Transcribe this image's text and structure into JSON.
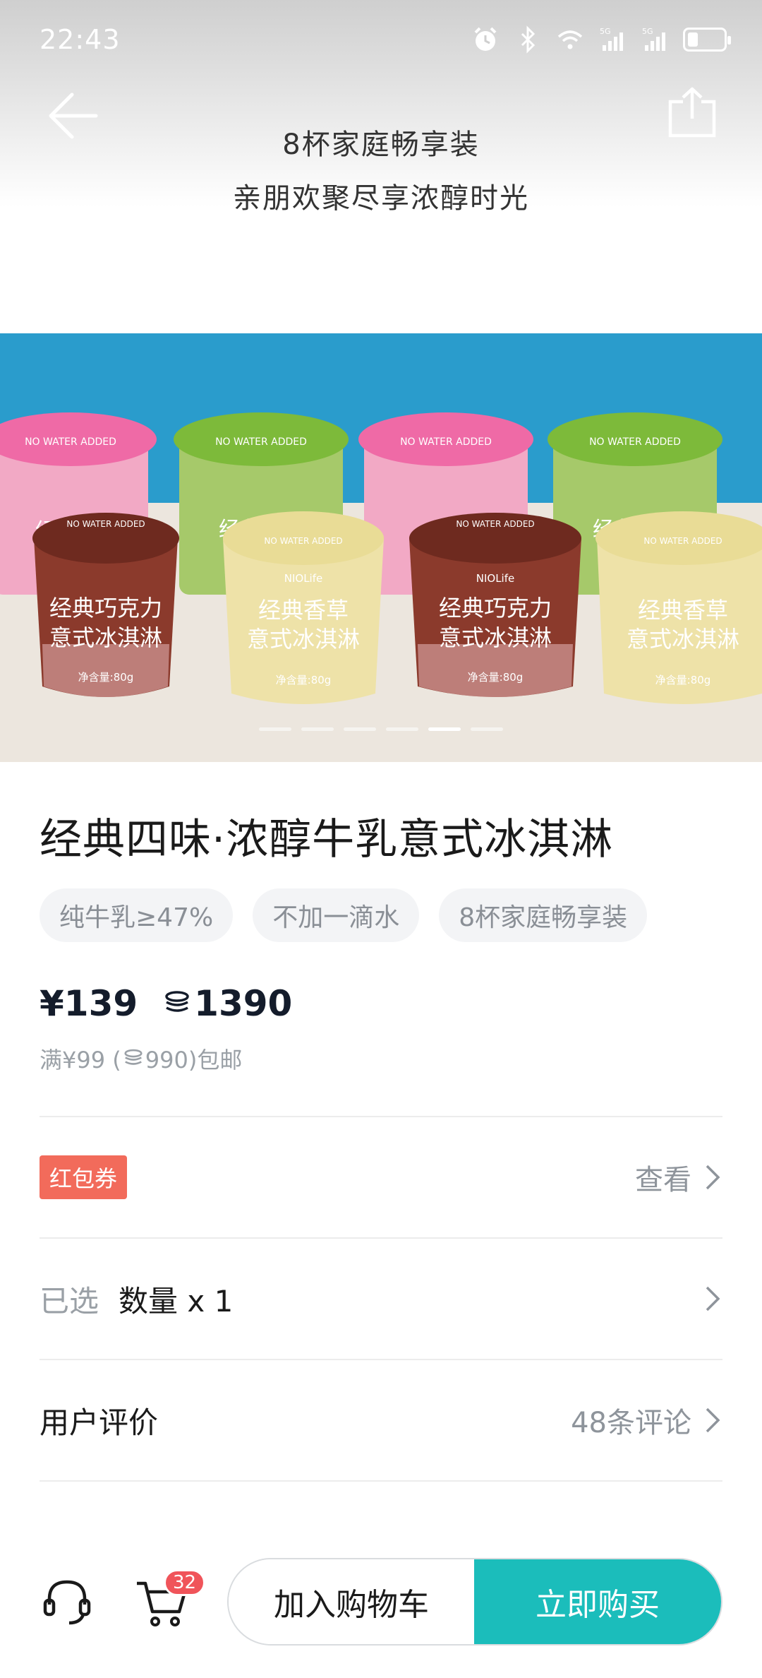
{
  "status_bar": {
    "time": "22:43",
    "signal1": "5G",
    "signal2": "5G"
  },
  "header": {
    "promo_line1": "8杯家庭畅享装",
    "promo_line2": "亲朋欢聚尽享浓醇时光"
  },
  "banner": {
    "slide_count": 6,
    "active_slide": 5,
    "cup_top_text": "NO WATER ADDED",
    "brand": "NIOLife",
    "cups": [
      {
        "name_line1": "经典巧克力",
        "name_line2": "意式冰淇淋",
        "net": "净含量:80g"
      },
      {
        "name_line1": "经典香草",
        "name_line2": "意式冰淇淋",
        "net": "净含量:80g"
      },
      {
        "name_line1": "经典巧克力",
        "name_line2": "意式冰淇淋",
        "net": "净含量:80g"
      },
      {
        "name_line1": "经典香草",
        "name_line2": "意式冰淇淋",
        "net": "净含量:80g"
      }
    ],
    "back_cup_text": "经典抹茶",
    "back_cup_text_pink": "经典"
  },
  "product": {
    "title": "经典四味·浓醇牛乳意式冰淇淋",
    "tags": [
      "纯牛乳≥47%",
      "不加一滴水",
      "8杯家庭畅享装"
    ],
    "price": "¥139",
    "coin_price": "1390",
    "shipping_prefix": "满¥99 (",
    "shipping_coins": "990)包邮"
  },
  "rows": {
    "coupon_label": "红包券",
    "coupon_action": "查看",
    "selected_label": "已选",
    "selected_value": "数量 x 1",
    "review_label": "用户评价",
    "review_count": "48条评论"
  },
  "bottom_bar": {
    "cart_badge": "32",
    "add_to_cart": "加入购物车",
    "buy_now": "立即购买"
  },
  "colors": {
    "accent": "#1bbdbb",
    "badge_red": "#f0545a",
    "coupon_red": "#f26b5b",
    "banner_blue": "#2a9ccc"
  }
}
